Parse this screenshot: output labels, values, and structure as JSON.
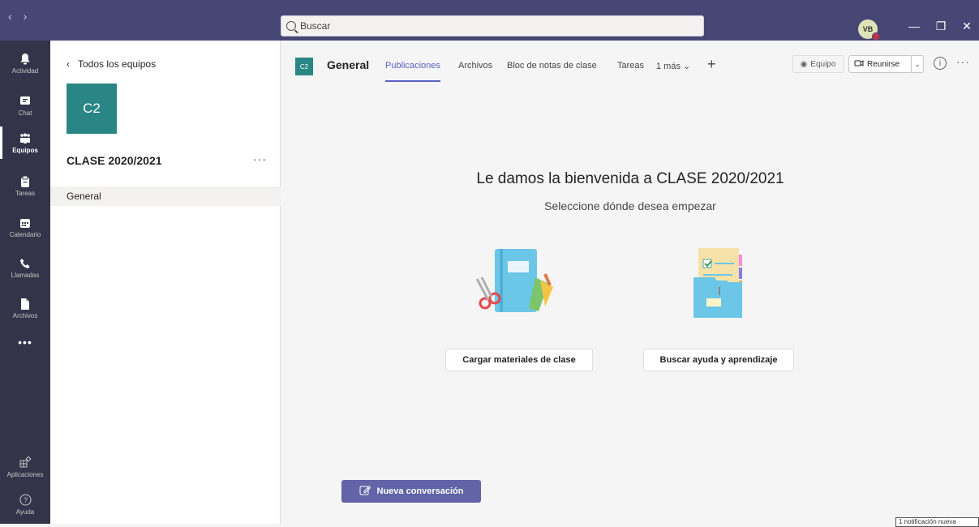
{
  "titlebar": {
    "search_placeholder": "Buscar",
    "avatar_initials": "VB",
    "minimize_glyph": "—",
    "restore_glyph": "❐",
    "close_glyph": "✕"
  },
  "rail": {
    "items": [
      {
        "label": "Actividad",
        "icon": "bell-icon"
      },
      {
        "label": "Chat",
        "icon": "chat-icon"
      },
      {
        "label": "Equipos",
        "icon": "teams-icon"
      },
      {
        "label": "Tareas",
        "icon": "assignments-icon"
      },
      {
        "label": "Calendario",
        "icon": "calendar-icon"
      },
      {
        "label": "Llamadas",
        "icon": "phone-icon"
      },
      {
        "label": "Archivos",
        "icon": "file-icon"
      }
    ],
    "more": "•••",
    "apps_label": "Aplicaciones",
    "help_label": "Ayuda"
  },
  "team_panel": {
    "back_label": "Todos los equipos",
    "tile_initials": "C2",
    "team_name": "CLASE 2020/2021",
    "more": "···",
    "channels": [
      "General"
    ]
  },
  "channel_header": {
    "tile_initials": "C2",
    "title": "General",
    "tabs": [
      "Publicaciones",
      "Archivos",
      "Bloc de notas de clase",
      "Tareas",
      "1 más"
    ],
    "active_tab": "Publicaciones",
    "team_button": "Equipo",
    "meet_button": "Reunirse"
  },
  "welcome": {
    "title": "Le damos la bienvenida a CLASE 2020/2021",
    "subtitle": "Seleccione dónde desea empezar",
    "upload_button": "Cargar materiales de clase",
    "help_button": "Buscar ayuda y aprendizaje"
  },
  "compose": {
    "new_conversation": "Nueva conversación"
  },
  "status": {
    "notification": "1 notificación nueva"
  },
  "colors": {
    "titlebar": "#464775",
    "rail": "#33344a",
    "brand": "#6264a7",
    "team_tile": "#2a8585",
    "active_tab": "#5b5fc7"
  }
}
